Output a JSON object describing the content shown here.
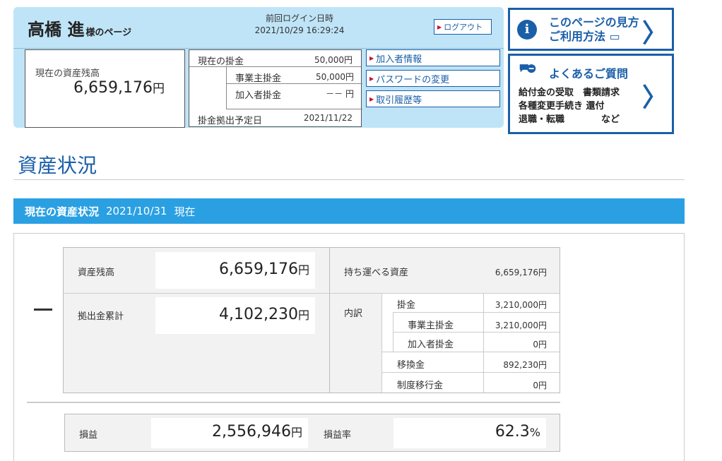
{
  "header": {
    "user_name": "高橋 進",
    "user_suffix": "様のページ",
    "last_login_label": "前回ログイン日時",
    "last_login_value": "2021/10/29 16:29:24",
    "logout_label": "ログアウト",
    "balance_label": "現在の資産残高",
    "balance_value": "6,659,176",
    "balance_unit": "円",
    "contrib_label": "現在の掛金",
    "contrib_value": "50,000円",
    "employer_label": "事業主掛金",
    "employer_value": "50,000円",
    "member_label": "加入者掛金",
    "member_value": "－－ 円",
    "schedule_label": "掛金拠出予定日",
    "schedule_value": "2021/11/22",
    "links": [
      "加入者情報",
      "パスワードの変更",
      "取引履歴等"
    ]
  },
  "help": {
    "guide_title_1": "このページの見方",
    "guide_title_2": "ご利用方法 ▭",
    "faq_title": "よくあるご質問",
    "faq_lines": [
      "給付金の受取　書類請求",
      "各種変更手続き 還付",
      "退職・転職　　　　など"
    ]
  },
  "section": {
    "title": "資産状況",
    "bar_label": "現在の資産状況",
    "bar_date": "2021/10/31",
    "bar_suffix": "現在"
  },
  "assets": {
    "toggle_symbol": "—",
    "balance_label": "資産残高",
    "balance_value": "6,659,176",
    "cum_label": "拠出金累計",
    "cum_value": "4,102,230",
    "unit": "円",
    "portable_label": "持ち運べる資産",
    "portable_value": "6,659,176円",
    "breakdown_label": "内訳",
    "rows": [
      {
        "label": "掛金",
        "value": "3,210,000円"
      },
      {
        "label": "事業主掛金",
        "value": "3,210,000円"
      },
      {
        "label": "加入者掛金",
        "value": "0円"
      },
      {
        "label": "移換金",
        "value": "892,230円"
      },
      {
        "label": "制度移行金",
        "value": "0円"
      }
    ],
    "pl_label": "損益",
    "pl_value": "2,556,946",
    "rate_label": "損益率",
    "rate_value": "62.3",
    "rate_unit": "%"
  }
}
